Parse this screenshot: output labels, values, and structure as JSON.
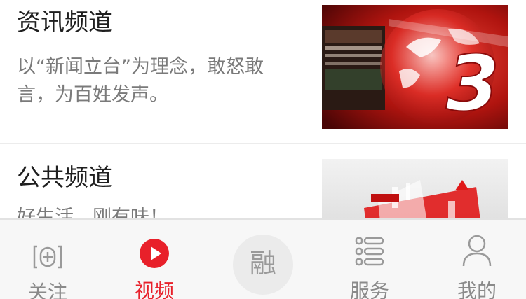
{
  "channels": [
    {
      "title": "资讯频道",
      "description": "以“新闻立台”为理念，敢怒敢言，为百姓发声。",
      "thumbnail_icon": "news-channel-3-logo"
    },
    {
      "title": "公共频道",
      "description": "好生活，刚有味！",
      "thumbnail_icon": "public-channel-logo"
    }
  ],
  "tabbar": {
    "tabs": [
      {
        "label": "关注",
        "icon": "follow-plus-icon",
        "active": false
      },
      {
        "label": "视频",
        "icon": "video-play-icon",
        "active": true
      },
      {
        "label": "融",
        "icon": "center-rong-button",
        "active": false
      },
      {
        "label": "服务",
        "icon": "service-list-icon",
        "active": false
      },
      {
        "label": "我的",
        "icon": "user-profile-icon",
        "active": false
      }
    ]
  },
  "colors": {
    "accent": "#e8202a",
    "inactive": "#8a8a8a",
    "tabbar_bg": "#f7f7f7"
  }
}
